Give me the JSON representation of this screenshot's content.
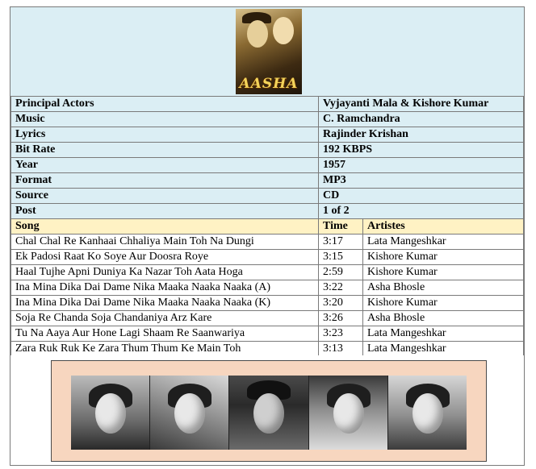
{
  "poster": {
    "title": "AASHA"
  },
  "details": [
    {
      "label": "Principal Actors",
      "value": "Vyjayanti Mala & Kishore Kumar"
    },
    {
      "label": "Music",
      "value": "C. Ramchandra"
    },
    {
      "label": "Lyrics",
      "value": "Rajinder Krishan"
    },
    {
      "label": "Bit Rate",
      "value": "192 KBPS"
    },
    {
      "label": "Year",
      "value": "1957"
    },
    {
      "label": "Format",
      "value": "MP3"
    },
    {
      "label": "Source",
      "value": "CD"
    },
    {
      "label": "Post",
      "value": "1 of 2"
    }
  ],
  "songs_header": {
    "song": "Song",
    "time": "Time",
    "artistes": "Artistes"
  },
  "songs": [
    {
      "song": "Chal Chal Re Kanhaai Chhaliya Main Toh Na Dungi",
      "time": "3:17",
      "artiste": "Lata Mangeshkar"
    },
    {
      "song": "Ek Padosi Raat Ko Soye Aur Doosra Roye",
      "time": "3:15",
      "artiste": "Kishore Kumar"
    },
    {
      "song": "Haal Tujhe Apni Duniya Ka Nazar Toh Aata Hoga",
      "time": "2:59",
      "artiste": "Kishore Kumar"
    },
    {
      "song": "Ina Mina Dika Dai Dame Nika Maaka Naaka Naaka (A)",
      "time": "3:22",
      "artiste": "Asha Bhosle"
    },
    {
      "song": "Ina Mina Dika Dai Dame Nika Maaka Naaka Naaka (K)",
      "time": "3:20",
      "artiste": "Kishore Kumar"
    },
    {
      "song": "Soja Re Chanda Soja Chandaniya Arz Kare",
      "time": "3:26",
      "artiste": "Asha Bhosle"
    },
    {
      "song": "Tu Na Aaya Aur Hone Lagi Shaam Re Saanwariya",
      "time": "3:23",
      "artiste": "Lata Mangeshkar"
    },
    {
      "song": "Zara Ruk Ruk Ke Zara Thum Thum Ke Main Toh",
      "time": "3:13",
      "artiste": "Lata Mangeshkar"
    }
  ],
  "colors": {
    "meta_bg": "#dbeef4",
    "header_bg": "#fff2c4",
    "strip_bg": "#f7d6bf"
  }
}
